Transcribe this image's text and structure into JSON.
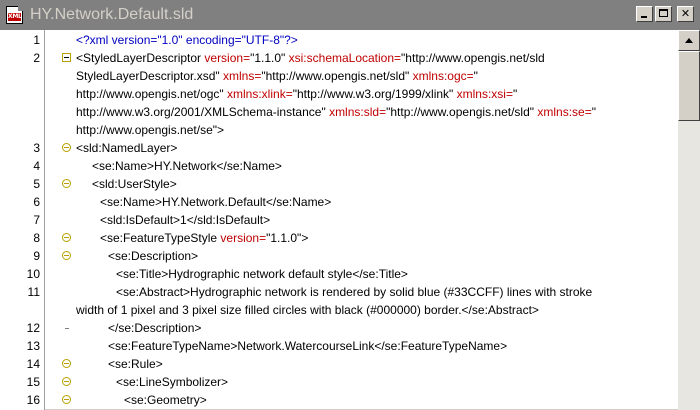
{
  "window": {
    "title": "HY.Network.Default.sld",
    "icon": "xml-file-icon",
    "icon_label": "XML"
  },
  "gutter_line_numbers": [
    "1",
    "2",
    "3",
    "4",
    "5",
    "6",
    "7",
    "8",
    "9",
    "10",
    "11",
    "12",
    "13",
    "14",
    "15",
    "16"
  ],
  "lines": [
    {
      "num": "1",
      "marker": "none",
      "parts": [
        {
          "t": "<?xml version=\"1.0\" encoding=\"UTF-8\"?>",
          "c": "blue"
        }
      ],
      "indent": 0
    },
    {
      "num": "2",
      "marker": "minus-square",
      "parts": [
        {
          "t": "<StyledLayerDescriptor ",
          "c": "black"
        },
        {
          "t": "version=",
          "c": "red"
        },
        {
          "t": "\"1.1.0\" ",
          "c": "black"
        },
        {
          "t": "xsi:schemaLocation=",
          "c": "red"
        },
        {
          "t": "\"http://www.opengis.net/sld",
          "c": "black"
        }
      ],
      "indent": 0
    },
    {
      "num": "",
      "marker": "none",
      "parts": [
        {
          "t": "StyledLayerDescriptor.xsd\" ",
          "c": "black"
        },
        {
          "t": "xmlns=",
          "c": "red"
        },
        {
          "t": "\"http://www.opengis.net/sld\" ",
          "c": "black"
        },
        {
          "t": "xmlns:ogc=",
          "c": "red"
        },
        {
          "t": "\"",
          "c": "black"
        }
      ],
      "indent": 0
    },
    {
      "num": "",
      "marker": "none",
      "parts": [
        {
          "t": "http://www.opengis.net/ogc\" ",
          "c": "black"
        },
        {
          "t": "xmlns:xlink=",
          "c": "red"
        },
        {
          "t": "\"http://www.w3.org/1999/xlink\" ",
          "c": "black"
        },
        {
          "t": "xmlns:xsi=",
          "c": "red"
        },
        {
          "t": "\"",
          "c": "black"
        }
      ],
      "indent": 0
    },
    {
      "num": "",
      "marker": "none",
      "parts": [
        {
          "t": "http://www.w3.org/2001/XMLSchema-instance\" ",
          "c": "black"
        },
        {
          "t": "xmlns:sld=",
          "c": "red"
        },
        {
          "t": "\"http://www.opengis.net/sld\" ",
          "c": "black"
        },
        {
          "t": "xmlns:se=",
          "c": "red"
        },
        {
          "t": "\"",
          "c": "black"
        }
      ],
      "indent": 0
    },
    {
      "num": "",
      "marker": "none",
      "parts": [
        {
          "t": "http://www.opengis.net/se\">",
          "c": "black"
        }
      ],
      "indent": 0
    },
    {
      "num": "3",
      "marker": "minus-circle",
      "parts": [
        {
          "t": "<sld:NamedLayer>",
          "c": "black"
        }
      ],
      "indent": 0
    },
    {
      "num": "4",
      "marker": "none",
      "parts": [
        {
          "t": "<se:Name>",
          "c": "black"
        },
        {
          "t": "HY.Network",
          "c": "black"
        },
        {
          "t": "</se:Name>",
          "c": "black"
        }
      ],
      "indent": 16
    },
    {
      "num": "5",
      "marker": "minus-circle",
      "parts": [
        {
          "t": "<sld:UserStyle>",
          "c": "black"
        }
      ],
      "indent": 16
    },
    {
      "num": "6",
      "marker": "none",
      "parts": [
        {
          "t": "<se:Name>",
          "c": "black"
        },
        {
          "t": "HY.Network.Default",
          "c": "black"
        },
        {
          "t": "</se:Name>",
          "c": "black"
        }
      ],
      "indent": 24
    },
    {
      "num": "7",
      "marker": "none",
      "parts": [
        {
          "t": "<sld:IsDefault>",
          "c": "black"
        },
        {
          "t": "1",
          "c": "black"
        },
        {
          "t": "</sld:IsDefault>",
          "c": "black"
        }
      ],
      "indent": 24
    },
    {
      "num": "8",
      "marker": "minus-circle",
      "parts": [
        {
          "t": "<se:FeatureTypeStyle ",
          "c": "black"
        },
        {
          "t": "version=",
          "c": "red"
        },
        {
          "t": "\"1.1.0\">",
          "c": "black"
        }
      ],
      "indent": 24
    },
    {
      "num": "9",
      "marker": "minus-circle",
      "parts": [
        {
          "t": "<se:Description>",
          "c": "black"
        }
      ],
      "indent": 32
    },
    {
      "num": "10",
      "marker": "none",
      "parts": [
        {
          "t": "<se:Title>",
          "c": "black"
        },
        {
          "t": "Hydrographic network default style",
          "c": "black"
        },
        {
          "t": "</se:Title>",
          "c": "black"
        }
      ],
      "indent": 40
    },
    {
      "num": "11",
      "marker": "none",
      "parts": [
        {
          "t": "<se:Abstract>",
          "c": "black"
        },
        {
          "t": "Hydrographic network is rendered by solid blue (#33CCFF) lines with stroke",
          "c": "black"
        }
      ],
      "indent": 40
    },
    {
      "num": "",
      "marker": "none",
      "parts": [
        {
          "t": "width of 1 pixel and 3 pixel size filled circles with black (#000000) border.",
          "c": "black"
        },
        {
          "t": "</se:Abstract>",
          "c": "black"
        }
      ],
      "indent": 0
    },
    {
      "num": "12",
      "marker": "tick",
      "parts": [
        {
          "t": "</se:Description>",
          "c": "black"
        }
      ],
      "indent": 32
    },
    {
      "num": "13",
      "marker": "none",
      "parts": [
        {
          "t": "<se:FeatureTypeName>",
          "c": "black"
        },
        {
          "t": "Network.WatercourseLink",
          "c": "black"
        },
        {
          "t": "</se:FeatureTypeName>",
          "c": "black"
        }
      ],
      "indent": 32
    },
    {
      "num": "14",
      "marker": "minus-circle",
      "parts": [
        {
          "t": "<se:Rule>",
          "c": "black"
        }
      ],
      "indent": 32
    },
    {
      "num": "15",
      "marker": "minus-circle",
      "parts": [
        {
          "t": "<se:LineSymbolizer>",
          "c": "black"
        }
      ],
      "indent": 40
    },
    {
      "num": "16",
      "marker": "minus-circle",
      "parts": [
        {
          "t": "<se:Geometry>",
          "c": "black"
        }
      ],
      "indent": 48
    }
  ],
  "colors": {
    "titlebar": "#808080",
    "title_text": "#d4d0c8",
    "pi_blue": "#0000c0",
    "attr_red": "#c00000",
    "fold_marker": "#b8a000"
  },
  "scrollbar": {
    "up_arrow": "scroll-up-arrow-icon"
  }
}
